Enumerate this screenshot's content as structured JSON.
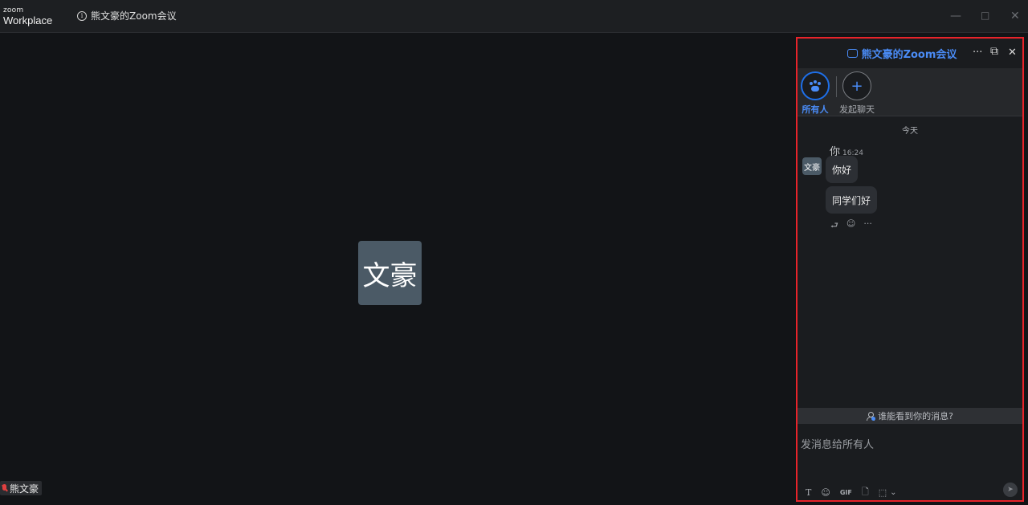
{
  "app": {
    "logo_top": "zoom",
    "logo_bottom": "Workplace"
  },
  "meeting": {
    "title": "熊文豪的Zoom会议",
    "info_icon": "info-icon"
  },
  "window_controls": {
    "minimize": "—",
    "maximize": "□",
    "close": "✕"
  },
  "video": {
    "avatar_text": "文豪",
    "participant_name": "熊文豪"
  },
  "chat": {
    "title": "熊文豪的Zoom会议",
    "more": "···",
    "popout": "⧉",
    "close": "✕",
    "recipients": [
      {
        "label": "所有人",
        "icon": "everyone-icon"
      },
      {
        "label": "发起聊天",
        "icon": "plus-icon",
        "symbol": "+"
      }
    ],
    "day_label": "今天",
    "message_group": {
      "avatar_text": "文豪",
      "sender": "你",
      "time": "16:24",
      "messages": [
        "你好",
        "同学们好"
      ],
      "actions": {
        "reply": "⮐",
        "emoji": "☺",
        "more": "···"
      }
    },
    "visibility_text": "谁能看到你的消息?",
    "composer": {
      "placeholder": "发消息给所有人",
      "tools": {
        "format": "T",
        "emoji": "☺",
        "gif": "GIF",
        "file": "🗋",
        "screenshot": "⬚",
        "dropdown": "⌄"
      },
      "send": "➤"
    }
  },
  "colors": {
    "accent": "#4a8cf7",
    "highlight_border": "#e8232a",
    "avatar_bg": "#4b5a66",
    "muted_mic": "#e04040"
  }
}
